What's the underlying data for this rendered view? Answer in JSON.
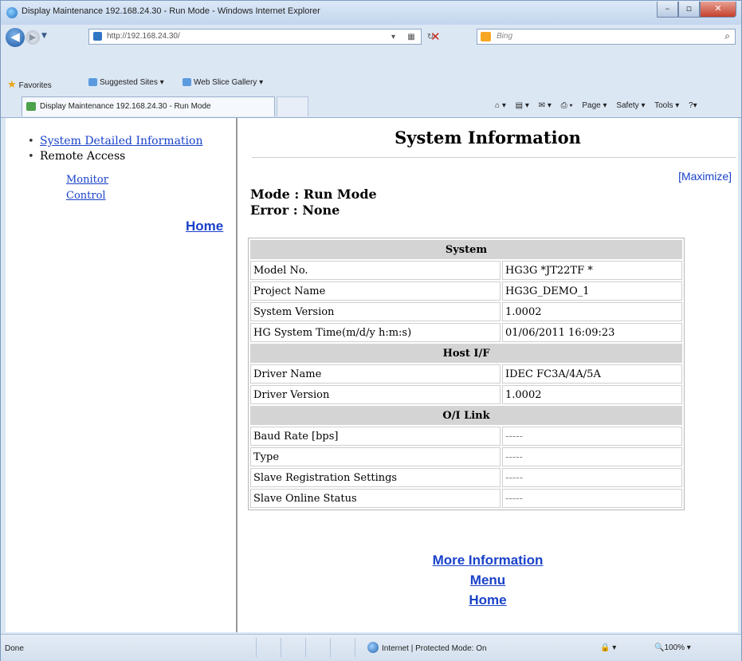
{
  "window": {
    "title": "Display Maintenance 192.168.24.30 - Run Mode - Windows Internet Explorer",
    "min_glyph": "–",
    "max_glyph": "▫",
    "close_glyph": "✕"
  },
  "addressbar": {
    "back_glyph": "◀",
    "forward_glyph": "▶",
    "url": "http://192.168.24.30/",
    "search_placeholder": "Bing",
    "search_glyph": "⌕",
    "stop_glyph": "✕"
  },
  "favorites": {
    "label": "Favorites",
    "suggested": "Suggested Sites ▾",
    "webslice": "Web Slice Gallery ▾"
  },
  "tab": {
    "label": "Display Maintenance 192.168.24.30 - Run Mode"
  },
  "commandbar": {
    "page": "Page ▾",
    "safety": "Safety ▾",
    "tools": "Tools ▾",
    "help": "?▾"
  },
  "sidebar": {
    "items": [
      {
        "label": "System Detailed Information",
        "link": true
      },
      {
        "label": "Remote Access",
        "link": false
      }
    ],
    "subitems": [
      "Monitor",
      "Control"
    ],
    "home": "Home"
  },
  "main": {
    "title": "System Information",
    "maximize": "[Maximize]",
    "mode": "Mode : Run Mode",
    "error": "Error : None",
    "sections": [
      {
        "header": "System",
        "rows": [
          [
            "Model No.",
            "HG3G *JT22TF *"
          ],
          [
            "Project Name",
            "HG3G_DEMO_1"
          ],
          [
            "System Version",
            "1.0002"
          ],
          [
            "HG System Time(m/d/y h:m:s)",
            "01/06/2011 16:09:23"
          ]
        ]
      },
      {
        "header": "Host I/F",
        "rows": [
          [
            "Driver Name",
            "IDEC FC3A/4A/5A"
          ],
          [
            "Driver Version",
            "1.0002"
          ]
        ]
      },
      {
        "header": "O/I Link",
        "rows": [
          [
            "Baud Rate [bps]",
            "-----"
          ],
          [
            "Type",
            "-----"
          ],
          [
            "Slave Registration Settings",
            "-----"
          ],
          [
            "Slave Online Status",
            "-----"
          ]
        ]
      }
    ],
    "bottom_links": [
      "More Information",
      "Menu",
      "Home"
    ]
  },
  "statusbar": {
    "status": "Done",
    "zone": "Internet | Protected Mode: On",
    "lock": "🔒 ▾",
    "zoom": "🔍100%  ▾"
  },
  "colors": {
    "link": "#1a42c9",
    "header_bg": "#d4d4d4",
    "chrome": "#dce7f4"
  }
}
